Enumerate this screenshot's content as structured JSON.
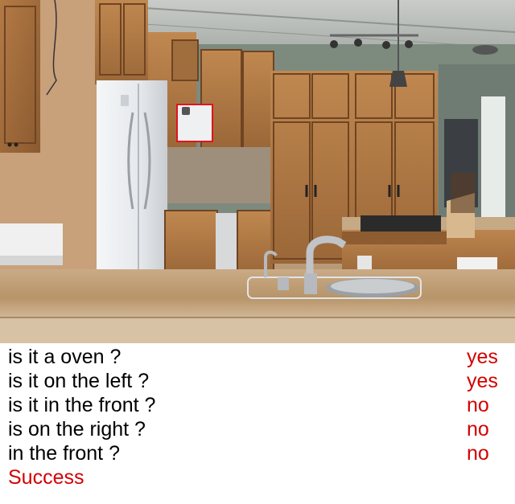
{
  "image": {
    "scene": "kitchen-photo",
    "highlight_color": "#e0141e"
  },
  "qa": [
    {
      "question": "is it a oven ?",
      "answer": "yes"
    },
    {
      "question": "is it on the left ?",
      "answer": "yes"
    },
    {
      "question": "is it in the front ?",
      "answer": "no"
    },
    {
      "question": "is on the right ?",
      "answer": "no"
    },
    {
      "question": "in the front ?",
      "answer": "no"
    }
  ],
  "status": {
    "text": "Success"
  },
  "colors": {
    "question": "#000000",
    "answer": "#d40000",
    "status": "#d40000"
  }
}
